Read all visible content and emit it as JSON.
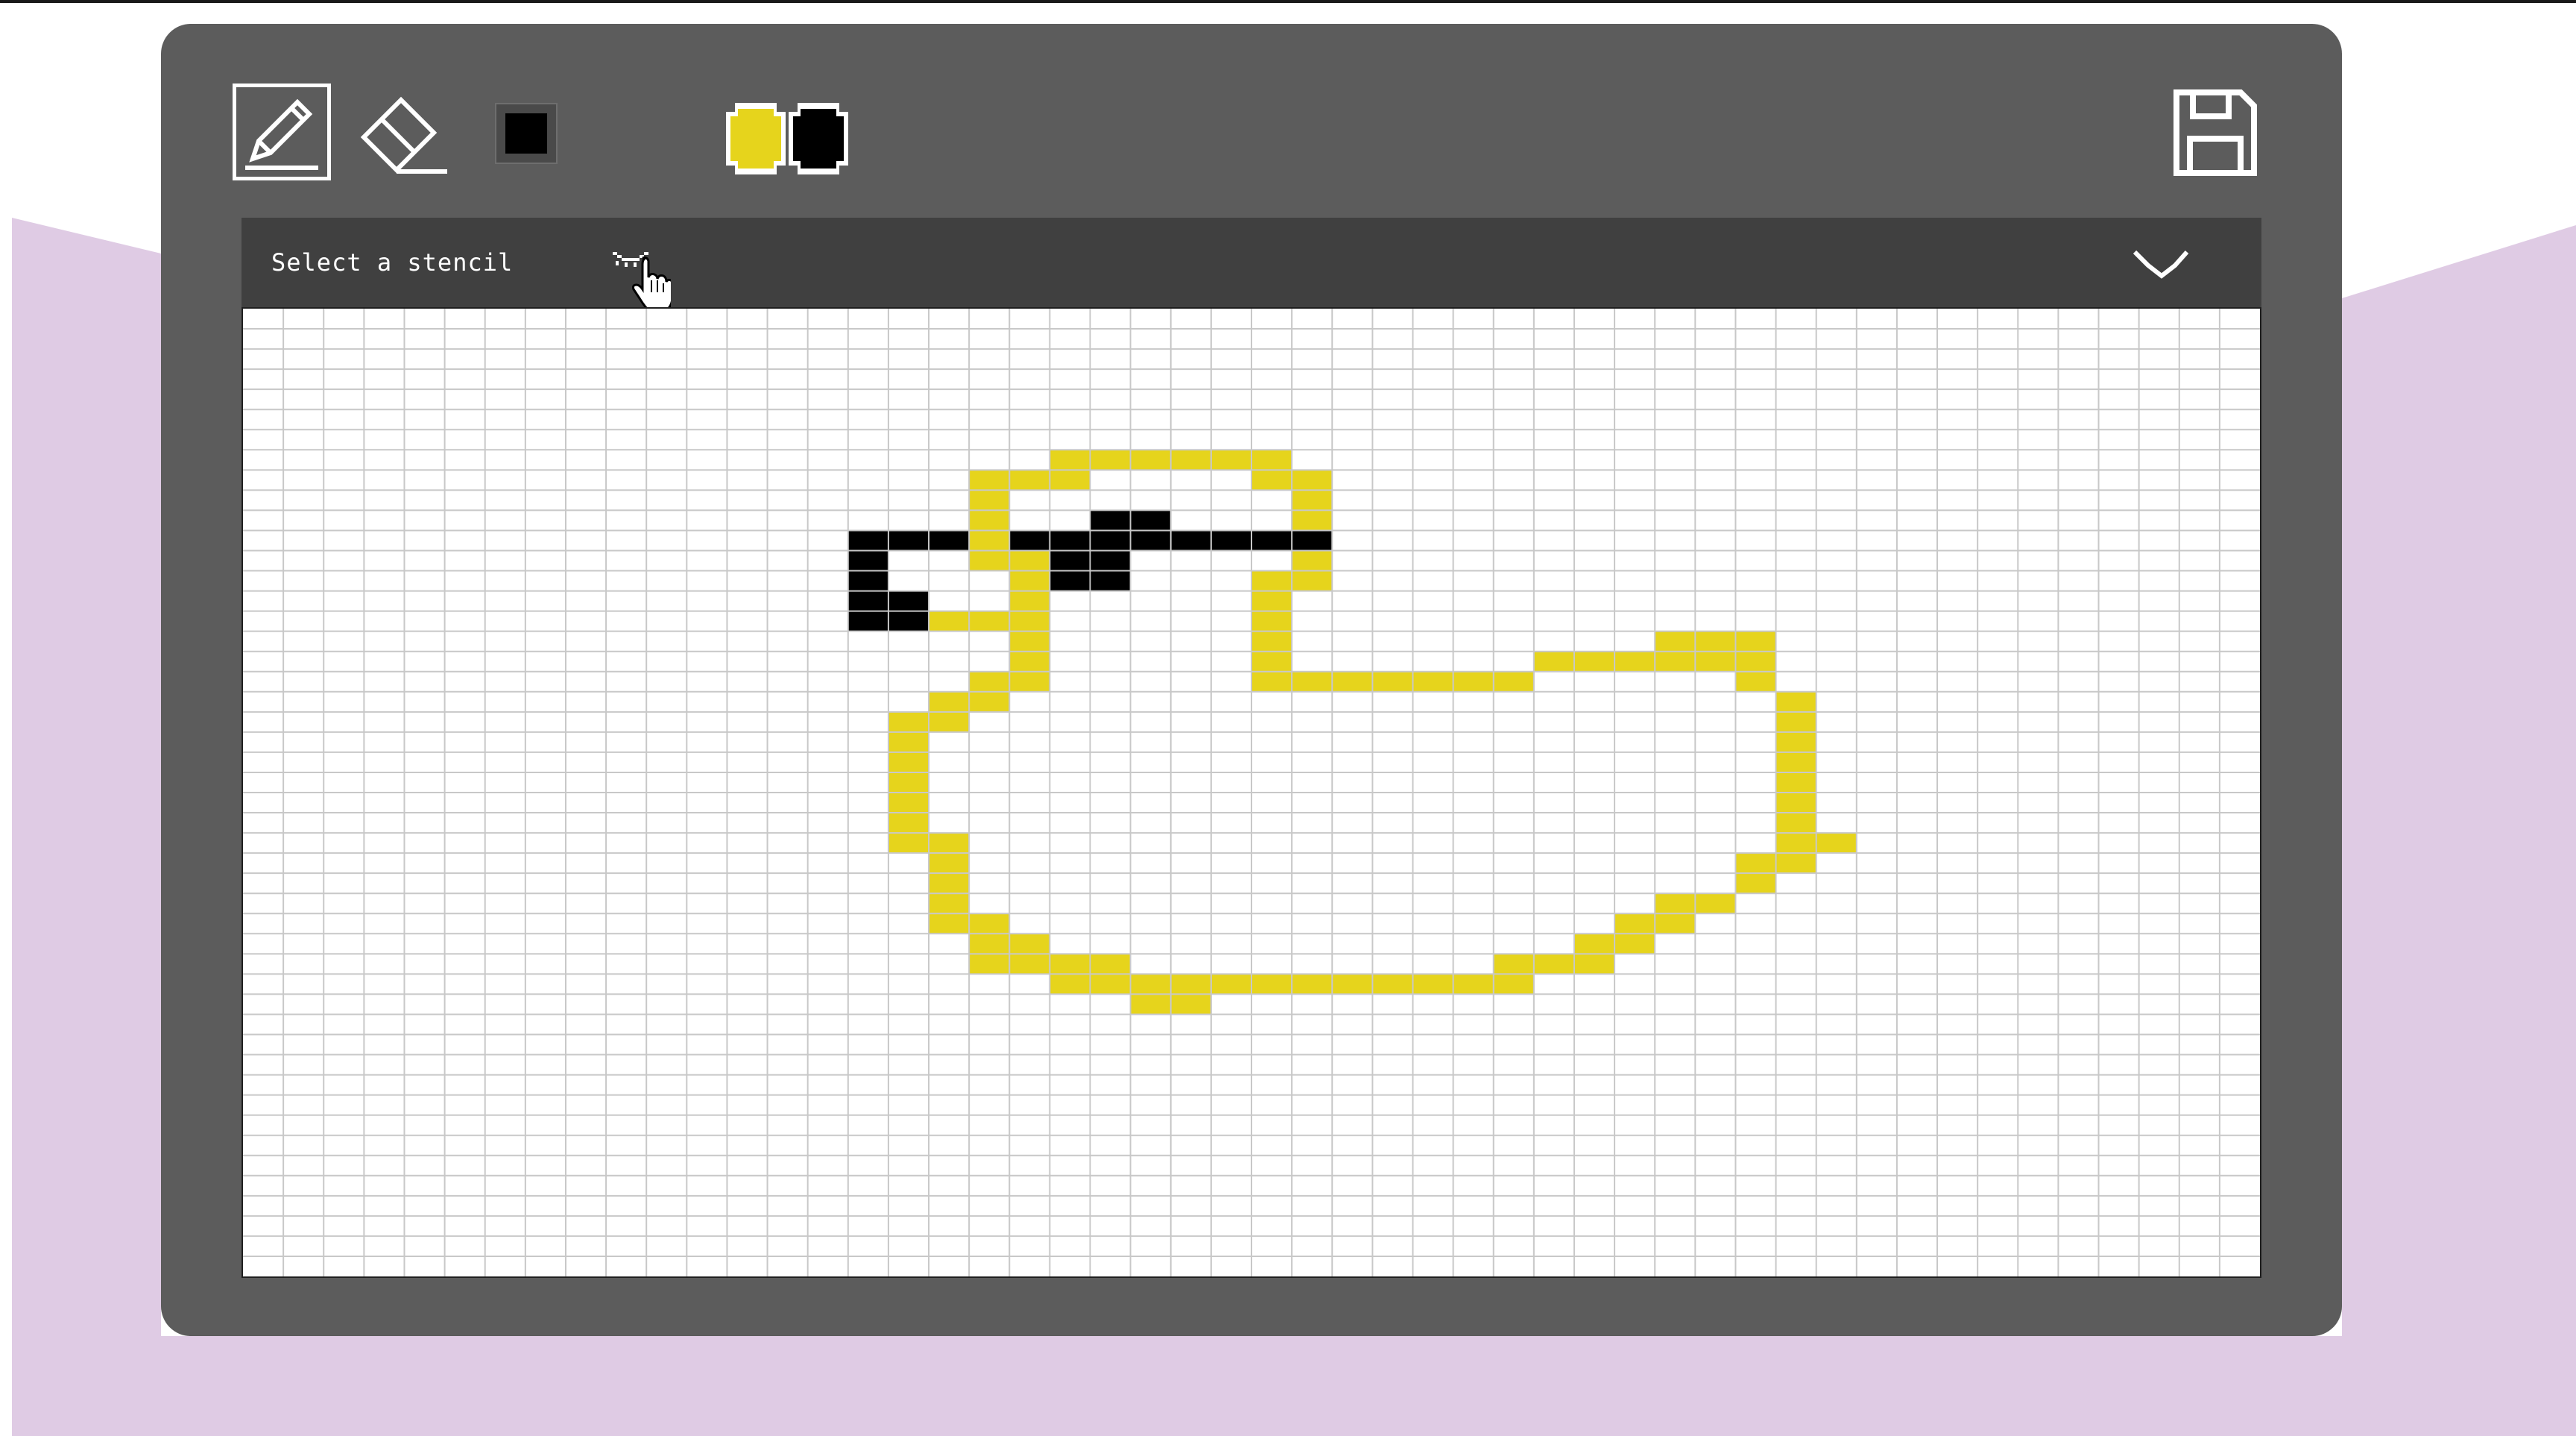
{
  "app": {
    "background_colors": [
      "#ffffff",
      "#dfcbe4"
    ],
    "panel_color": "#5c5c5c"
  },
  "toolbar": {
    "tools": [
      {
        "name": "pencil",
        "icon": "pencil-icon",
        "selected": true
      },
      {
        "name": "eraser",
        "icon": "eraser-icon",
        "selected": false
      },
      {
        "name": "fill",
        "icon": "fill-square-icon",
        "color": "#000000"
      }
    ],
    "colors": {
      "primary": "#e6d41c",
      "secondary": "#000000"
    },
    "save_icon": "floppy-disk-icon"
  },
  "stencil": {
    "label": "Select a stencil",
    "toggle_icon": "closed-eye-icon",
    "dropdown_icon": "chevron-down-icon"
  },
  "canvas": {
    "columns": 50,
    "rows": 48,
    "background": "#ffffff",
    "grid_color": "#c8c8c8",
    "palette": {
      "Y": "#e6d41c",
      "B": "#000000"
    },
    "pixels": [
      "..................................................",
      "..................................................",
      "..................................................",
      "..................................................",
      "..................................................",
      "..................................................",
      "..................................................",
      "....................YYYYYY........................",
      "..................YYY....YY.......................",
      "..................Y.......Y.......................",
      "..................Y..BB...Y.......................",
      "...............BBBYBBBBBBBB.......................",
      "...............B..YYBB....Y.......................",
      "...............B...YBB...YY.......................",
      "...............BB..Y.....Y........................",
      "...............BBYYY.....Y........................",
      "...................Y.....Y.........YYY...........",
      "...................Y.....Y......YYYYYY...........",
      "..................YY.....YYYYYYY.....Y...........",
      ".................YY...................Y..........",
      "................YY....................Y..........",
      "................Y.....................Y..........",
      "................Y.....................Y..........",
      "................Y.....................Y..........",
      "................Y.....................Y..........",
      "................Y.....................Y..........",
      "................YY....................YY..........",
      ".................Y...................YY...........",
      ".................Y...................Y............",
      ".................Y.................YY............",
      ".................YY...............YY.............",
      "..................YY.............YY..............",
      "..................YYYY.........YYY...............",
      "....................YYYYYYYYYYYY.................",
      "......................YY.........................",
      "..................................................",
      "..................................................",
      "..................................................",
      "..................................................",
      "..................................................",
      "..................................................",
      "..................................................",
      "..................................................",
      "..................................................",
      "..................................................",
      "..................................................",
      "..................................................",
      ".................................................."
    ]
  }
}
